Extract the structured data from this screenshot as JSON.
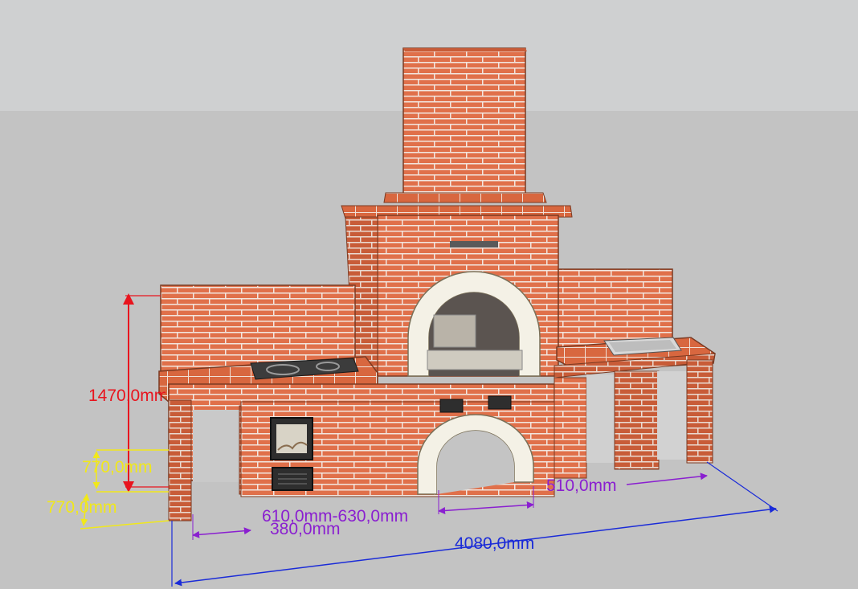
{
  "colors": {
    "sky": "#cfd0d1",
    "ground": "#c3c3c3",
    "brick": "#e0704a",
    "brick_dark": "#b8502e",
    "mortar": "#f2e6df",
    "arch": "#f4f1e6",
    "red_dim": "#e8141e",
    "yellow_dim": "#f1e81a",
    "purple_dim": "#8a1fd0",
    "blue_dim": "#1a2bd8"
  },
  "dimensions": {
    "total_height": "1470,0mm",
    "worktop_height": "770,0mm",
    "base_height": "770,0mm",
    "left_depth": "380,0mm",
    "center_span": "610,0mm-630,0mm",
    "right_span": "510,0mm",
    "total_length": "4080,0mm"
  }
}
